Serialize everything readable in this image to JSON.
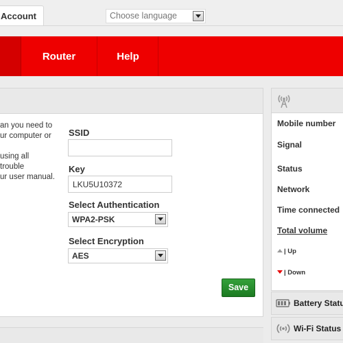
{
  "header": {
    "account_tab": "Account",
    "language_placeholder": "Choose language"
  },
  "nav": {
    "items": [
      {
        "label": "Router"
      },
      {
        "label": "Help"
      }
    ]
  },
  "main": {
    "info_lines": [
      "an you need to",
      "ur computer or",
      "",
      "using all",
      "trouble",
      "ur user manual."
    ],
    "ssid_label": "SSID",
    "ssid_value": "",
    "key_label": "Key",
    "key_value": "LKU5U10372",
    "auth_label": "Select Authentication",
    "auth_value": "WPA2-PSK",
    "enc_label": "Select Encryption",
    "enc_value": "AES",
    "save_label": "Save"
  },
  "status": {
    "head_icon": "antenna-icon",
    "rows": [
      {
        "label": "Mobile number"
      },
      {
        "label": "Signal"
      },
      {
        "label": "Status"
      },
      {
        "label": "Network"
      },
      {
        "label": "Time connected"
      },
      {
        "label": "Total volume"
      }
    ],
    "up_label": "| Up",
    "down_label": "| Down",
    "battery_label": "Battery Status",
    "wifi_label": "Wi-Fi Status"
  },
  "colors": {
    "brand_red": "#ee0000",
    "save_green": "#2a8f2f",
    "down_arrow": "#e60000"
  }
}
